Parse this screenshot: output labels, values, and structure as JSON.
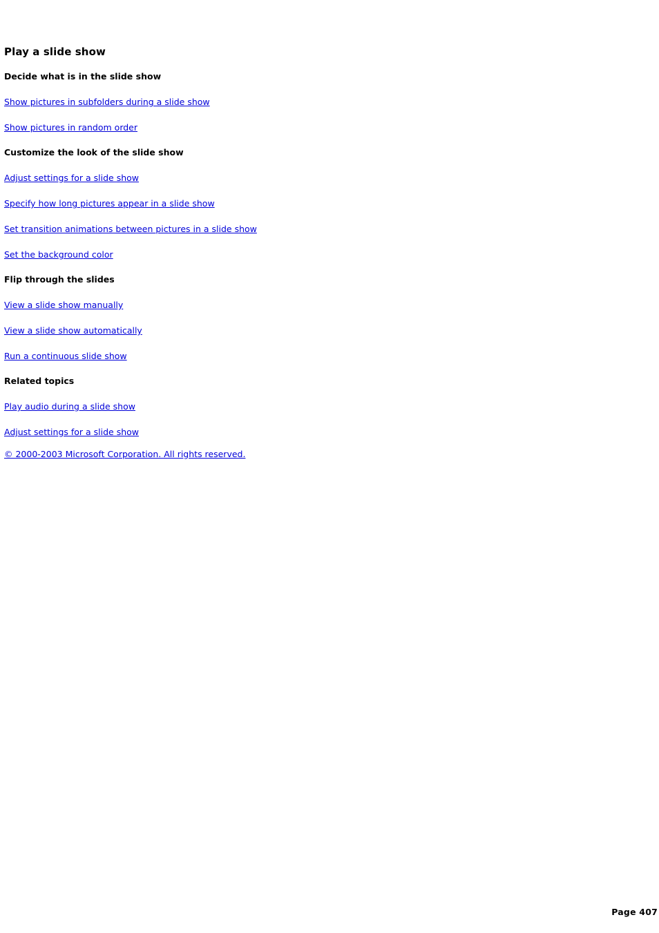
{
  "document": {
    "title": "Play a slide show",
    "page_label": "Page 407",
    "link_color": "#0000d8",
    "text_color": "#000000",
    "background_color": "#ffffff"
  },
  "sections": [
    {
      "heading": "Decide what is in the slide show",
      "links": [
        "Show pictures in subfolders during a slide show",
        "Show pictures in random order"
      ]
    },
    {
      "heading": "Customize the look of the slide show",
      "links": [
        "Adjust settings for a slide show",
        "Specify how long pictures appear in a slide show",
        "Set transition animations between pictures in a slide show",
        "Set the background color"
      ]
    },
    {
      "heading": "Flip through the slides",
      "links": [
        "View a slide show manually",
        "View a slide show automatically",
        "Run a continuous slide show"
      ]
    },
    {
      "heading": "Related topics",
      "links": [
        "Play audio during a slide show",
        "Adjust settings for a slide show"
      ]
    }
  ],
  "copyright": "© 2000-2003 Microsoft Corporation. All rights reserved."
}
